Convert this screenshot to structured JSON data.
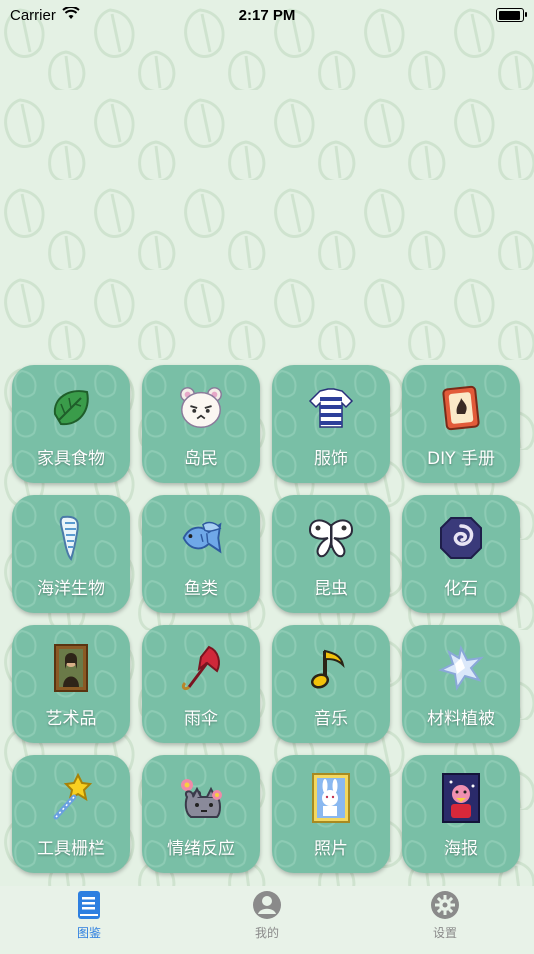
{
  "status_bar": {
    "carrier": "Carrier",
    "time": "2:17 PM",
    "battery_level": 0.95
  },
  "categories": [
    {
      "label": "家具食物",
      "icon": "leaf-icon"
    },
    {
      "label": "岛民",
      "icon": "villager-face-icon"
    },
    {
      "label": "服饰",
      "icon": "striped-shirt-icon"
    },
    {
      "label": "DIY 手册",
      "icon": "recipe-card-icon"
    },
    {
      "label": "海洋生物",
      "icon": "sea-creature-icon"
    },
    {
      "label": "鱼类",
      "icon": "fish-icon"
    },
    {
      "label": "昆虫",
      "icon": "butterfly-icon"
    },
    {
      "label": "化石",
      "icon": "fossil-icon"
    },
    {
      "label": "艺术品",
      "icon": "painting-icon"
    },
    {
      "label": "雨伞",
      "icon": "umbrella-icon"
    },
    {
      "label": "音乐",
      "icon": "music-note-icon"
    },
    {
      "label": "材料植被",
      "icon": "star-fragment-icon"
    },
    {
      "label": "工具栅栏",
      "icon": "star-wand-icon"
    },
    {
      "label": "情绪反应",
      "icon": "reaction-icon"
    },
    {
      "label": "照片",
      "icon": "photo-icon"
    },
    {
      "label": "海报",
      "icon": "poster-icon"
    }
  ],
  "tabs": [
    {
      "label": "图鉴",
      "icon": "book-icon",
      "active": true
    },
    {
      "label": "我的",
      "icon": "profile-icon",
      "active": false
    },
    {
      "label": "设置",
      "icon": "gear-icon",
      "active": false
    }
  ],
  "colors": {
    "tile_bg": "#79bfa6",
    "accent": "#2d7fe0",
    "background": "#e4f1e4"
  }
}
